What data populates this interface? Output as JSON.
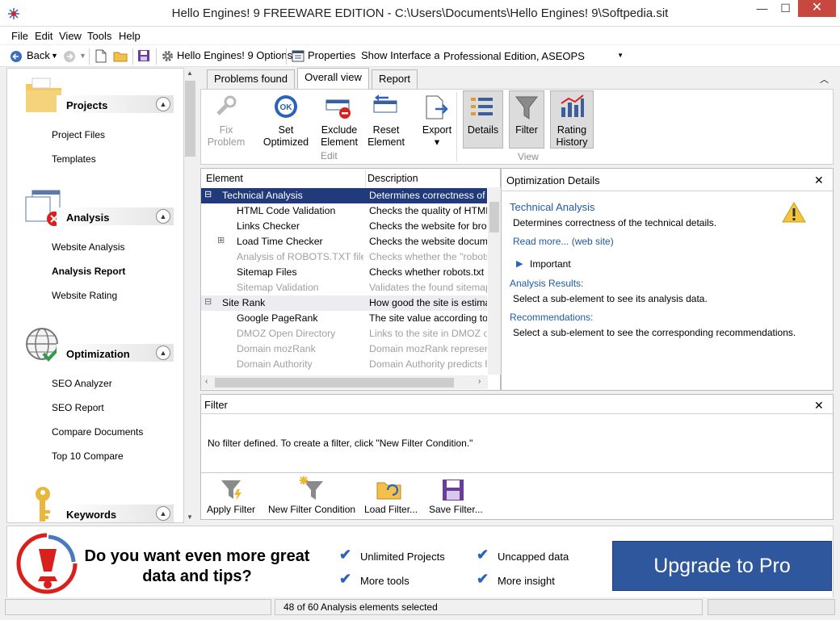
{
  "window": {
    "title": "Hello Engines! 9 FREEWARE EDITION - C:\\Users\\Documents\\Hello Engines! 9\\Softpedia.sit"
  },
  "menubar": [
    "File",
    "Edit",
    "View",
    "Tools",
    "Help"
  ],
  "toolbar": {
    "back": "Back",
    "options": "Hello Engines! 9 Options",
    "properties": "Properties",
    "show_interface_label": "Show Interface as:",
    "interface_value": "Professional Edition, ASEOPS"
  },
  "sidebar": {
    "groups": [
      {
        "label": "Projects",
        "icon": "folder-icon",
        "items": [
          "Project Files",
          "Templates"
        ]
      },
      {
        "label": "Analysis",
        "icon": "analysis-window-icon",
        "items": [
          "Website Analysis",
          "Analysis Report",
          "Website Rating"
        ]
      },
      {
        "label": "Optimization",
        "icon": "globe-check-icon",
        "items": [
          "SEO Analyzer",
          "SEO Report",
          "Compare Documents",
          "Top 10 Compare"
        ]
      },
      {
        "label": "Keywords",
        "icon": "key-icon",
        "items": []
      }
    ]
  },
  "tabs": [
    "Problems found",
    "Overall view",
    "Report"
  ],
  "active_tab": "Overall view",
  "ribbon": {
    "buttons": [
      {
        "line1": "Fix",
        "line2": "Problem",
        "icon": "wrench-icon",
        "disabled": true
      },
      {
        "line1": "Set",
        "line2": "Optimized",
        "icon": "ok-badge-icon",
        "disabled": false
      },
      {
        "line1": "Exclude",
        "line2": "Element",
        "icon": "exclude-icon",
        "disabled": false
      },
      {
        "line1": "Reset",
        "line2": "Element",
        "icon": "reset-icon",
        "disabled": false
      },
      {
        "line1": "Export",
        "line2": "▾",
        "icon": "export-icon",
        "disabled": false
      }
    ],
    "view_buttons": [
      {
        "line1": "Details",
        "line2": "",
        "icon": "details-list-icon"
      },
      {
        "line1": "Filter",
        "line2": "",
        "icon": "funnel-icon"
      },
      {
        "line1": "Rating",
        "line2": "History",
        "icon": "rating-history-icon"
      }
    ],
    "group_edit": "Edit",
    "group_view": "View"
  },
  "table": {
    "headers": [
      "Element",
      "Description"
    ],
    "rows": [
      {
        "element": "Technical Analysis",
        "desc": "Determines correctness of the",
        "level": 0,
        "expander": "⊟",
        "state": "selected"
      },
      {
        "element": "HTML Code Validation",
        "desc": "Checks the quality of HTML",
        "level": 1,
        "expander": "",
        "state": "normal"
      },
      {
        "element": "Links Checker",
        "desc": "Checks the website for brok",
        "level": 1,
        "expander": "",
        "state": "normal"
      },
      {
        "element": "Load Time Checker",
        "desc": "Checks the website docume",
        "level": 1,
        "expander": "⊞",
        "state": "normal"
      },
      {
        "element": "Analysis of ROBOTS.TXT file",
        "desc": "Checks whether the \"robots",
        "level": 1,
        "expander": "",
        "state": "dim"
      },
      {
        "element": "Sitemap Files",
        "desc": "Checks whether robots.txt h",
        "level": 1,
        "expander": "",
        "state": "normal"
      },
      {
        "element": "Sitemap Validation",
        "desc": "Validates the found sitemap",
        "level": 1,
        "expander": "",
        "state": "dim"
      },
      {
        "element": "Site Rank",
        "desc": "How good the site is estimat",
        "level": 0,
        "expander": "⊟",
        "state": "group"
      },
      {
        "element": "Google PageRank",
        "desc": "The site value according to G",
        "level": 1,
        "expander": "",
        "state": "normal"
      },
      {
        "element": "DMOZ Open Directory",
        "desc": "Links to the site in DMOZ op",
        "level": 1,
        "expander": "",
        "state": "dim"
      },
      {
        "element": "Domain mozRank",
        "desc": "Domain mozRank represent",
        "level": 1,
        "expander": "",
        "state": "dim"
      },
      {
        "element": "Domain Authority",
        "desc": "Domain Authority predicts h",
        "level": 1,
        "expander": "",
        "state": "dim"
      }
    ]
  },
  "details": {
    "header": "Optimization Details",
    "title": "Technical Analysis",
    "text": "Determines correctness of the technical details.",
    "read_more": "Read more... (web site)",
    "important": "Important",
    "results_label": "Analysis Results:",
    "results_text": "Select a sub-element to see its analysis data.",
    "rec_label": "Recommendations:",
    "rec_text": "Select a sub-element to see the corresponding recommendations."
  },
  "filter": {
    "header": "Filter",
    "message": "No filter defined. To create a filter, click \"New Filter Condition.\"",
    "buttons": [
      "Apply Filter",
      "New Filter Condition",
      "Load Filter...",
      "Save Filter..."
    ]
  },
  "banner": {
    "line1": "Do you want even more great",
    "line2": "data and tips?",
    "features": [
      "Unlimited Projects",
      "Uncapped data",
      "More tools",
      "More insight"
    ],
    "cta": "Upgrade to Pro"
  },
  "status": {
    "text": "48 of 60 Analysis elements selected"
  },
  "colors": {
    "selection": "#203a7c",
    "cta": "#2f579e",
    "accent_red": "#d9201c",
    "link": "#1e5aa8"
  }
}
